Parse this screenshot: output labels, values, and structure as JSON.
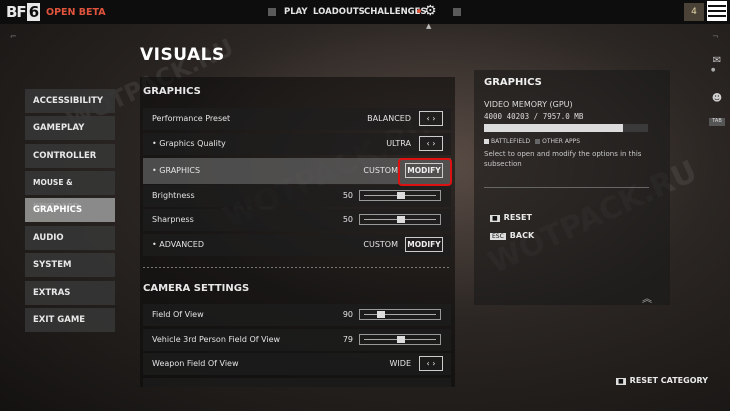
{
  "topbar": {
    "logo_text": "BF",
    "logo_num": "6",
    "beta_label": "OPEN BETA",
    "nav": [
      "PLAY",
      "LOADOUTS",
      "CHALLENGES"
    ],
    "level": "4"
  },
  "page_title": "VISUALS",
  "menu": [
    {
      "label": "ACCESSIBILITY",
      "active": false
    },
    {
      "label": "GAMEPLAY",
      "active": false
    },
    {
      "label": "CONTROLLER",
      "active": false
    },
    {
      "label": "MOUSE & KEYBOARD",
      "active": false
    },
    {
      "label": "GRAPHICS",
      "active": true
    },
    {
      "label": "AUDIO",
      "active": false
    },
    {
      "label": "SYSTEM",
      "active": false
    },
    {
      "label": "EXTRAS",
      "active": false
    },
    {
      "label": "EXIT GAME",
      "active": false
    }
  ],
  "graphics": {
    "section_title": "GRAPHICS",
    "rows": [
      {
        "label": "Performance Preset",
        "value": "BALANCED",
        "control": "arrows"
      },
      {
        "label": "• Graphics Quality",
        "value": "ULTRA",
        "control": "arrows"
      },
      {
        "label": "• GRAPHICS",
        "value": "CUSTOM",
        "control": "modify",
        "button": "MODIFY"
      },
      {
        "label": "Brightness",
        "value": "50",
        "control": "slider",
        "level": 0.5
      },
      {
        "label": "Sharpness",
        "value": "50",
        "control": "slider",
        "level": 0.5
      },
      {
        "label": "• ADVANCED",
        "value": "CUSTOM",
        "control": "modify",
        "button": "MODIFY"
      }
    ]
  },
  "camera": {
    "section_title": "CAMERA SETTINGS",
    "rows": [
      {
        "label": "Field Of View",
        "value": "90",
        "control": "slider",
        "level": 0.2
      },
      {
        "label": "Vehicle 3rd Person Field Of View",
        "value": "79",
        "control": "slider",
        "level": 0.5
      },
      {
        "label": "Weapon Field Of View",
        "value": "WIDE",
        "control": "arrows"
      }
    ]
  },
  "info_panel": {
    "title": "GRAPHICS",
    "memory_label": "VIDEO MEMORY (GPU)",
    "memory_value": "4000 40203 / 7957.0 MB",
    "memory_fill": 0.85,
    "legend_battlefield": "BATTLEFIELD",
    "legend_other": "OTHER APPS",
    "description": "Select to open and modify the options in this subsection",
    "reset_label": "RESET",
    "back_label": "BACK",
    "reset_category_label": "RESET CATEGORY"
  },
  "watermark": "WOTPACK.RU",
  "colors": {
    "accent_red": "#d11111",
    "beta_red": "#e0533c"
  }
}
